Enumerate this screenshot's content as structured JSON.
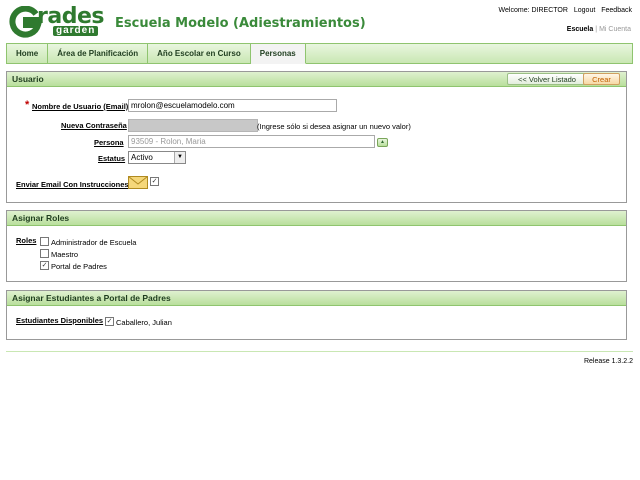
{
  "header": {
    "logo_main": "rades",
    "logo_sub": "garden",
    "school_title": "Escuela Modelo (Adiestramientos)",
    "welcome": "Welcome: DIRECTOR",
    "logout": "Logout",
    "feedback": "Feedback",
    "school_link": "Escuela",
    "account_link": "Mi Cuenta"
  },
  "nav": {
    "items": [
      {
        "label": "Home"
      },
      {
        "label": "Área de Planificación"
      },
      {
        "label": "Año Escolar en Curso"
      },
      {
        "label": "Personas",
        "active": true
      }
    ]
  },
  "usuario": {
    "title": "Usuario",
    "back_label": "<< Volver Listado",
    "create_label": "Crear",
    "username_label": "Nombre de Usuario (Email)",
    "username_value": "mrolon@escuelamodelo.com",
    "password_label": "Nueva Contraseña",
    "password_hint": "(Ingrese sólo si desea asignar un nuevo valor)",
    "persona_label": "Persona",
    "persona_value": "93509 - Rolon, Maria",
    "status_label": "Estatus",
    "status_value": "Activo",
    "email_label": "Enviar Email Con Instrucciones",
    "email_checked": true
  },
  "roles": {
    "title": "Asignar Roles",
    "label": "Roles",
    "items": [
      {
        "label": "Administrador de Escuela",
        "checked": false
      },
      {
        "label": "Maestro",
        "checked": false
      },
      {
        "label": "Portal de Padres",
        "checked": true
      }
    ]
  },
  "students": {
    "title": "Asignar Estudiantes a Portal de Padres",
    "label": "Estudiantes Disponibles",
    "items": [
      {
        "label": "Caballero, Julian",
        "checked": true
      }
    ]
  },
  "footer": {
    "release": "Release 1.3.2.2"
  },
  "colors": {
    "accent_green": "#3a8a3a",
    "nav_border": "#8fc46f",
    "required": "#c00000"
  }
}
